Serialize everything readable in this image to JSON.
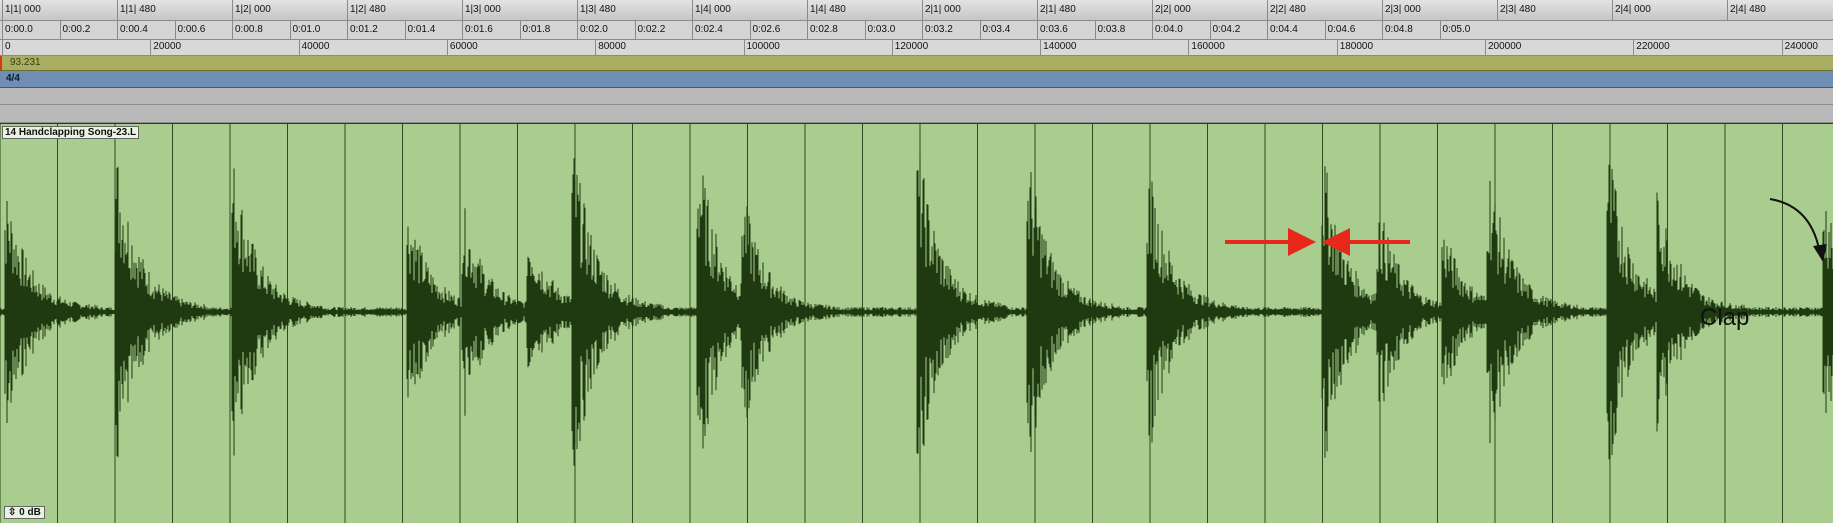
{
  "rulers": {
    "bars_beats": [
      "1|1| 000",
      "1|1| 480",
      "1|2| 000",
      "1|2| 480",
      "1|3| 000",
      "1|3| 480",
      "1|4| 000",
      "1|4| 480",
      "2|1| 000",
      "2|1| 480",
      "2|2| 000",
      "2|2| 480",
      "2|3| 000",
      "2|3| 480",
      "2|4| 000",
      "2|4| 480"
    ],
    "timecode": [
      "0:00.0",
      "0:00.2",
      "0:00.4",
      "0:00.6",
      "0:00.8",
      "0:01.0",
      "0:01.2",
      "0:01.4",
      "0:01.6",
      "0:01.8",
      "0:02.0",
      "0:02.2",
      "0:02.4",
      "0:02.6",
      "0:02.8",
      "0:03.0",
      "0:03.2",
      "0:03.4",
      "0:03.6",
      "0:03.8",
      "0:04.0",
      "0:04.2",
      "0:04.4",
      "0:04.6",
      "0:04.8",
      "0:05.0"
    ],
    "samples": [
      "0",
      "20000",
      "40000",
      "60000",
      "80000",
      "100000",
      "120000",
      "140000",
      "160000",
      "180000",
      "200000",
      "220000",
      "240000"
    ]
  },
  "tempo": {
    "value": "93.231"
  },
  "meter": {
    "value": "4/4"
  },
  "clip": {
    "name": "14 Handclapping Song-23.L",
    "gain": "0 dB",
    "gain_icon": "fader-icon"
  },
  "annotation": {
    "label": "Clap"
  },
  "colors": {
    "clip_bg": "#a9cd8e",
    "waveform": "#1f3a10",
    "arrow": "#e8281b",
    "tempo_lane": "#a8ad5f",
    "meter_lane": "#6e8fb3"
  }
}
